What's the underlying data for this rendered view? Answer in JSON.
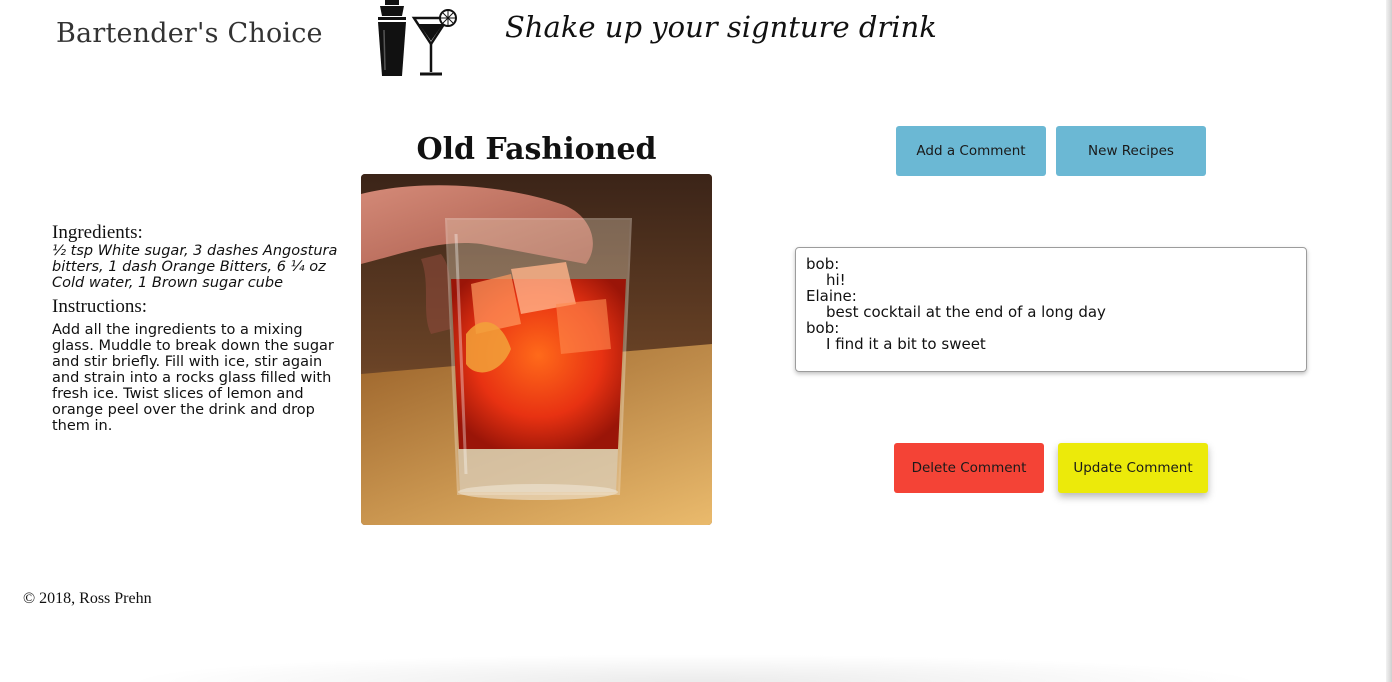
{
  "header": {
    "brand": "Bartender's Choice",
    "logo_icon": "shaker-and-martini-glass-icon",
    "tagline": "Shake up your signture drink"
  },
  "drink": {
    "title": "Old Fashioned",
    "image_icon": "old-fashioned-cocktail-photo",
    "ingredients_heading": "Ingredients:",
    "ingredients": "½ tsp White sugar, 3 dashes Angostura bitters, 1 dash Orange Bitters, 6 ¼ oz Cold water, 1 Brown sugar cube",
    "instructions_heading": "Instructions:",
    "instructions": "Add all the ingredients to a mixing glass. Muddle to break down the sugar and stir briefly. Fill with ice, stir again and strain into a rocks glass filled with fresh ice. Twist slices of lemon and orange peel over the drink and drop them in."
  },
  "actions": {
    "add_comment": "Add a Comment",
    "new_recipes": "New Recipes",
    "delete_comment": "Delete Comment",
    "update_comment": "Update Comment"
  },
  "comments": [
    {
      "user": "bob:",
      "text": "hi!"
    },
    {
      "user": "Elaine:",
      "text": "best cocktail at the end of a long day"
    },
    {
      "user": "bob:",
      "text": "I find it a bit to sweet"
    }
  ],
  "footer": {
    "copyright": "© 2018, Ross Prehn"
  },
  "colors": {
    "info_button": "#6bb8d4",
    "delete_button": "#f44336",
    "update_button": "#ecea0a"
  }
}
